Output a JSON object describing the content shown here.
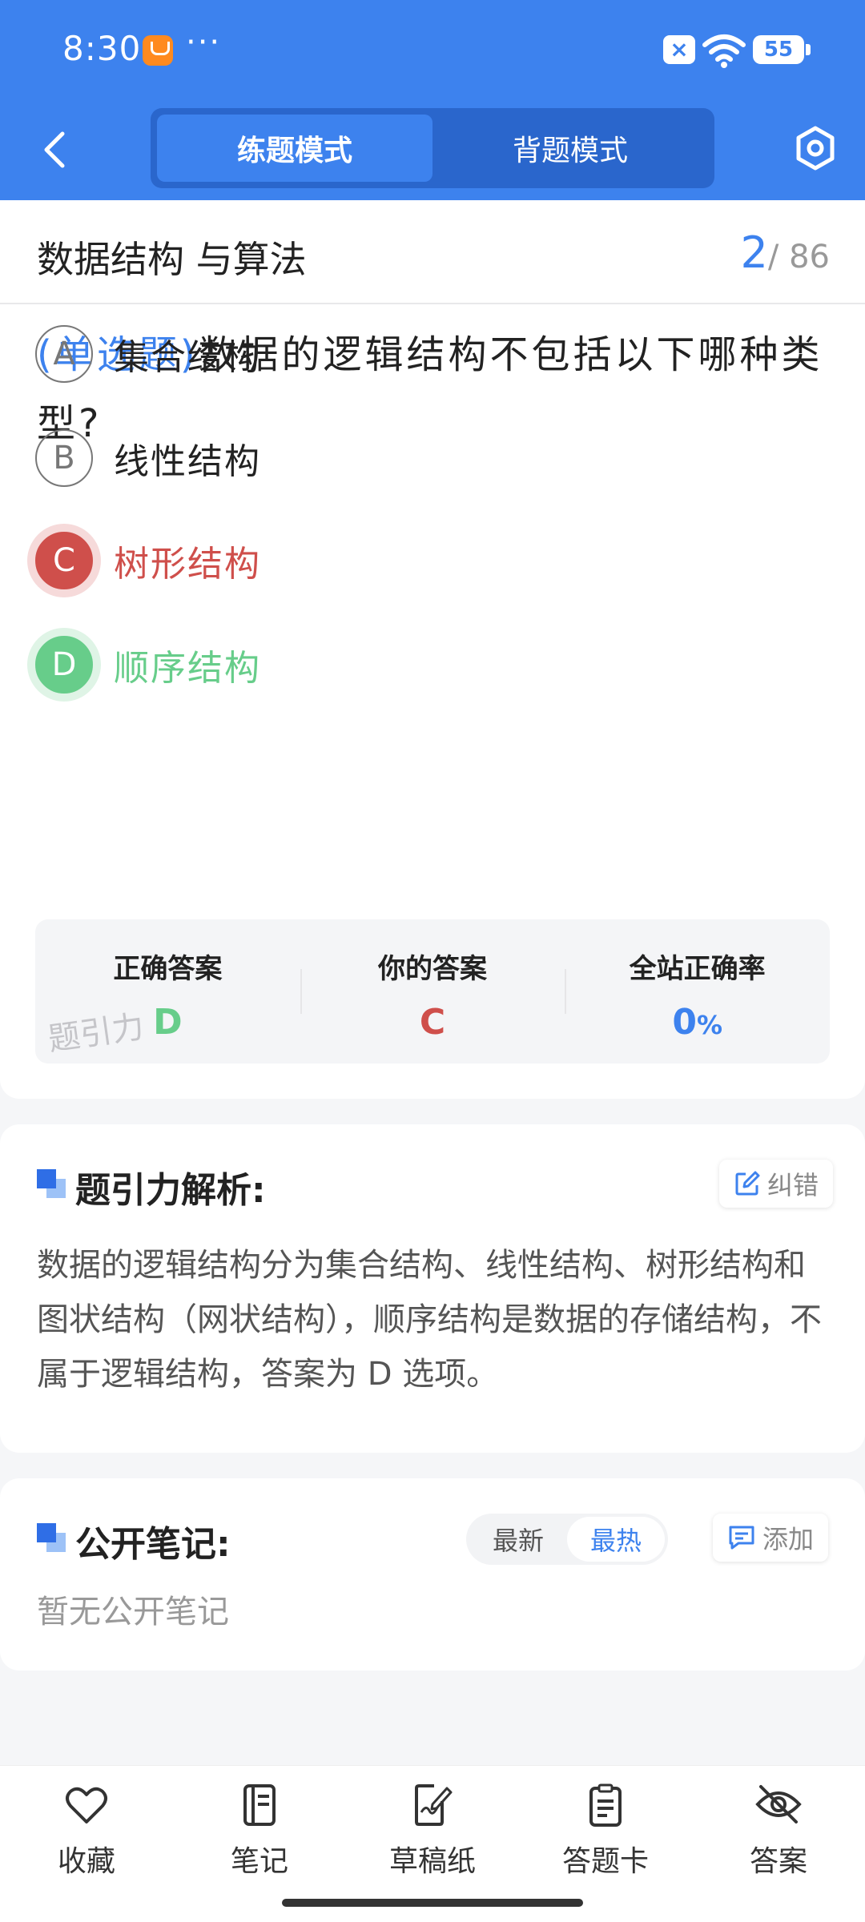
{
  "status_bar": {
    "time": "8:30",
    "dots": "···",
    "battery": "55"
  },
  "nav": {
    "tabs": [
      {
        "label": "练题模式",
        "active": true
      },
      {
        "label": "背题模式",
        "active": false
      }
    ]
  },
  "question": {
    "subject": "数据结构 与算法",
    "current": "2",
    "total": "/ 86",
    "type": "(单选题)",
    "text": "数据的逻辑结构不包括以下哪种类型?",
    "options": [
      {
        "letter": "A",
        "text": "集合结构",
        "state": "normal"
      },
      {
        "letter": "B",
        "text": "线性结构",
        "state": "normal"
      },
      {
        "letter": "C",
        "text": "树形结构",
        "state": "wrong"
      },
      {
        "letter": "D",
        "text": "顺序结构",
        "state": "correct"
      }
    ]
  },
  "answer_summary": {
    "correct_label": "正确答案",
    "correct_value": "D",
    "yours_label": "你的答案",
    "yours_value": "C",
    "rate_label": "全站正确率",
    "rate_value": "0",
    "rate_unit": "%",
    "watermark": "题引力"
  },
  "analysis": {
    "title": "题引力解析:",
    "report_label": "纠错",
    "text": "数据的逻辑结构分为集合结构、线性结构、树形结构和图状结构（网状结构），顺序结构是数据的存储结构，不属于逻辑结构，答案为 D 选项。"
  },
  "notes": {
    "title": "公开笔记:",
    "sort_newest": "最新",
    "sort_hottest": "最热",
    "add_label": "添加",
    "empty_text": "暂无公开笔记"
  },
  "bottom_bar": {
    "items": [
      {
        "label": "收藏",
        "icon": "heart-icon"
      },
      {
        "label": "笔记",
        "icon": "notebook-icon"
      },
      {
        "label": "草稿纸",
        "icon": "draft-paper-icon"
      },
      {
        "label": "答题卡",
        "icon": "answer-sheet-icon"
      },
      {
        "label": "答案",
        "icon": "eye-off-icon"
      }
    ]
  },
  "colors": {
    "brand_blue": "#3d82ee",
    "wrong_red": "#cf4f4b",
    "correct_green": "#67cd8a"
  }
}
